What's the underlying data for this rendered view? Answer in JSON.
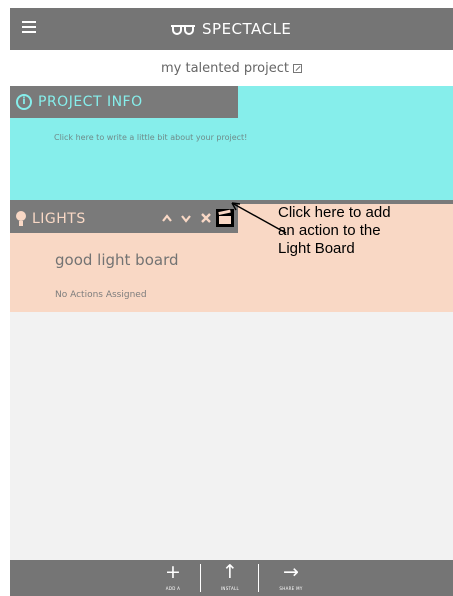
{
  "app": {
    "brand_name": "SPECTACLE",
    "menu_icon": "hamburger-icon",
    "brand_icon": "glasses-icon"
  },
  "project": {
    "title": "my talented project",
    "edit_icon": "edit-icon"
  },
  "info_section": {
    "title": "PROJECT INFO",
    "icon": "info-icon",
    "description": "Click here to write a little bit about your project!"
  },
  "lights_section": {
    "title": "LIGHTS",
    "icon": "lightbulb-icon",
    "controls": {
      "up_glyph": "^",
      "down_glyph": "v",
      "delete_glyph": "✕",
      "add_action_icon": "clapperboard-icon"
    },
    "board_name": "good light board",
    "status": "No Actions Assigned"
  },
  "annotation": {
    "lines": [
      "Click here to add",
      "an action to the",
      "Light Board"
    ]
  },
  "bottom_bar": {
    "add": {
      "glyph": "+",
      "label": "ADD A",
      "icon": "plus-icon"
    },
    "install": {
      "glyph": "↑",
      "label": "INSTALL",
      "icon": "arrow-up-icon"
    },
    "share": {
      "glyph": "→",
      "label": "SHARE MY",
      "icon": "arrow-right-icon"
    }
  },
  "colors": {
    "bar_gray": "#757575",
    "header_gray": "#7a7a7a",
    "info_cyan": "#86eeeb",
    "lights_peach": "#f9d8c5",
    "canvas": "#f2f2f2"
  }
}
